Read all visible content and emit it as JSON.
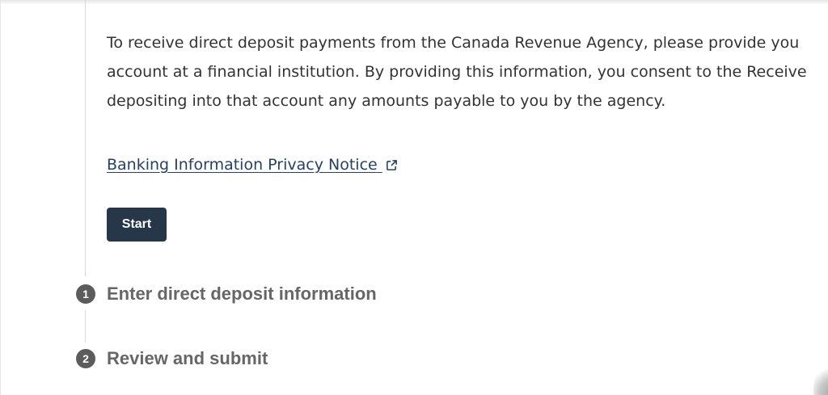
{
  "intro": {
    "lines": [
      "To receive direct deposit payments from the Canada Revenue Agency, please provide you",
      "account at a financial institution. By providing this information, you consent to the Receive",
      "depositing into that account any amounts payable to you by the agency."
    ]
  },
  "privacy_link": {
    "label": "Banking Information Privacy Notice",
    "icon": "external-link-icon"
  },
  "start_button": {
    "label": "Start"
  },
  "steps": [
    {
      "number": "1",
      "title": "Enter direct deposit information"
    },
    {
      "number": "2",
      "title": "Review and submit"
    }
  ],
  "colors": {
    "link": "#284162",
    "button": "#26374a",
    "step_badge": "#5c5c5c",
    "step_title": "#666666",
    "body_text": "#333333"
  }
}
